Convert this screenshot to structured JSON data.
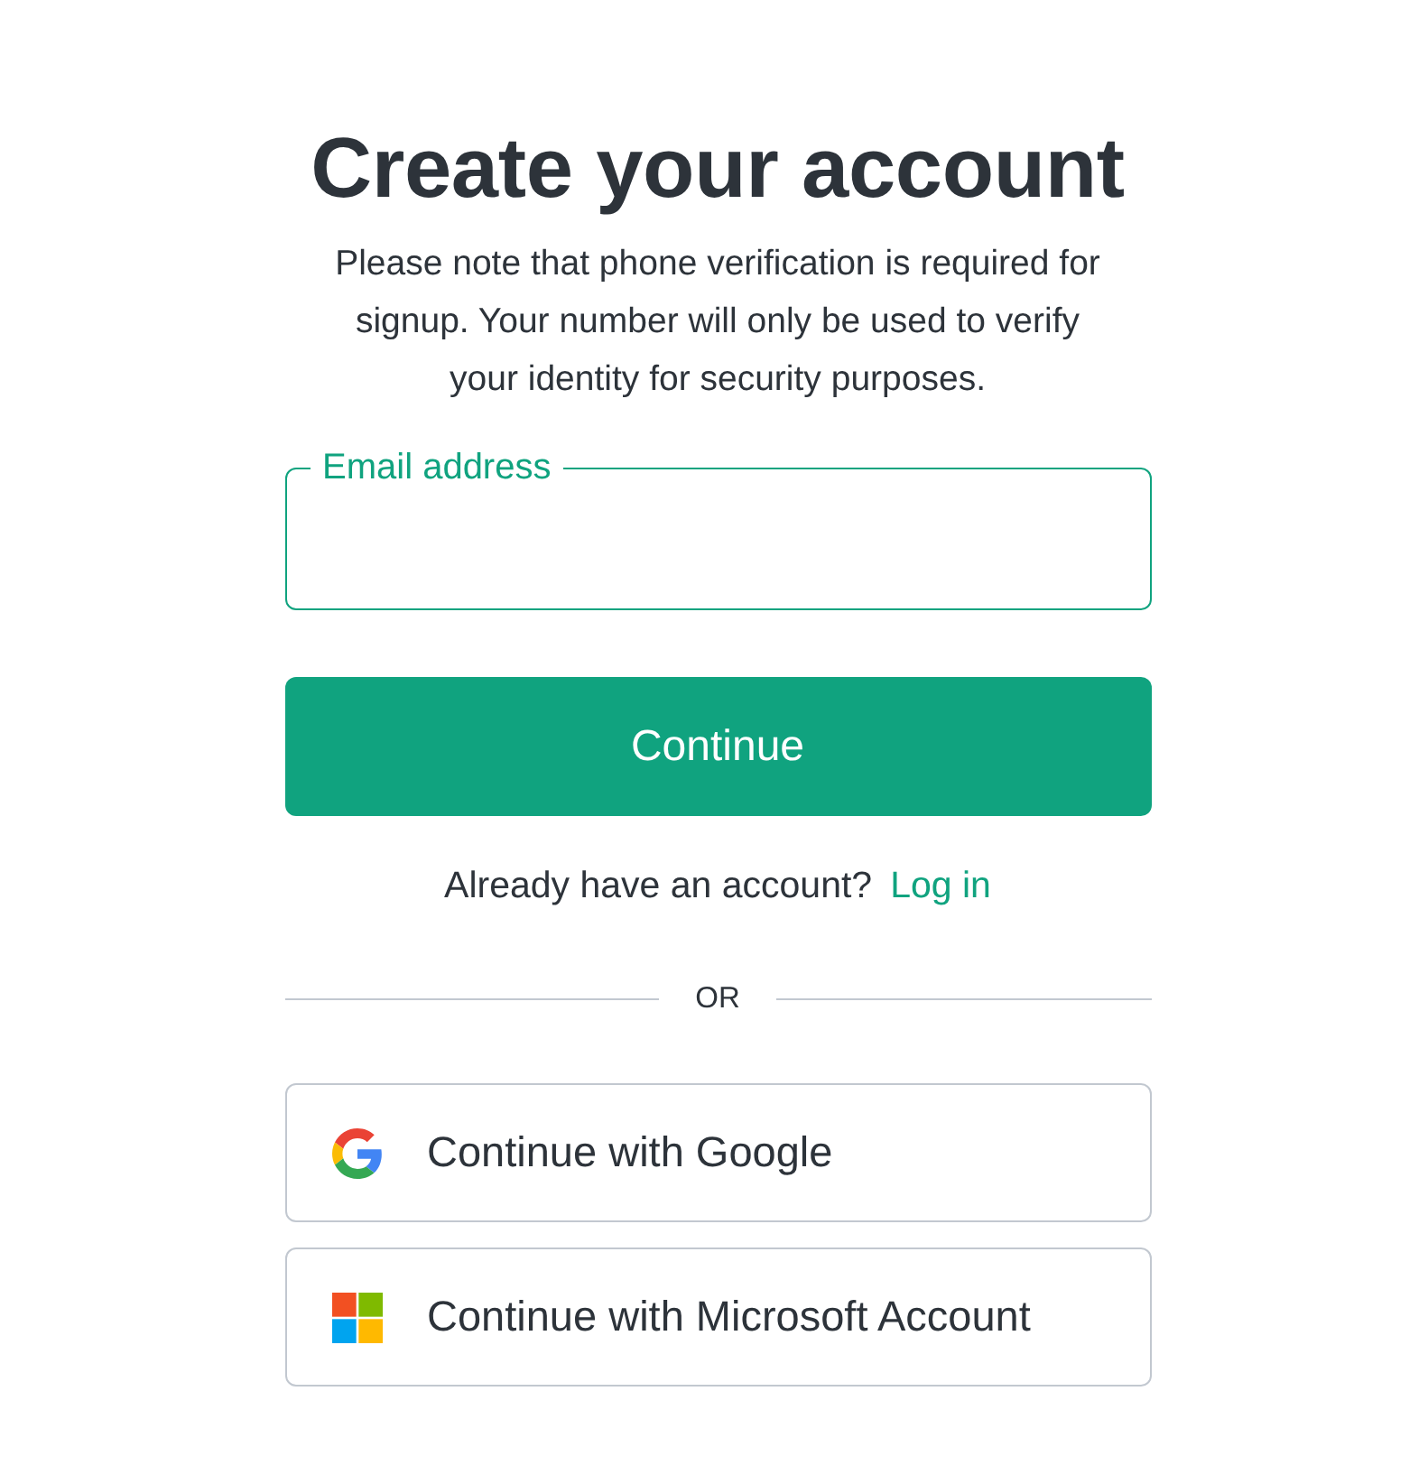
{
  "title": "Create your account",
  "note": "Please note that phone verification is required for signup. Your number will only be used to verify your identity for security purposes.",
  "email_field": {
    "label": "Email address",
    "focused": true
  },
  "continue_button": "Continue",
  "login_prompt": {
    "text": "Already have an account?",
    "link": "Log in"
  },
  "divider": "OR",
  "providers": [
    {
      "kind": "google",
      "label": "Continue with Google"
    },
    {
      "kind": "microsoft",
      "label": "Continue with Microsoft Account"
    }
  ]
}
